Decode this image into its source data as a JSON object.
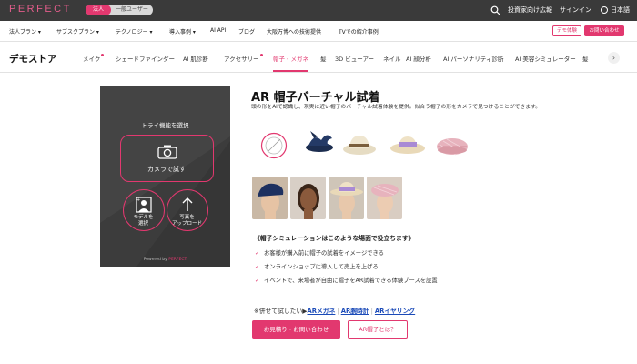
{
  "topbar": {
    "logo": "PERFECT",
    "segment_corporate": "法人",
    "segment_general": "一般ユーザー",
    "investor_label": "投資家向け広報",
    "signin_label": "サインイン",
    "language_label": "日本語"
  },
  "nav": {
    "items": [
      "法人プラン ▾",
      "サブスクプラン ▾",
      "テクノロジー ▾",
      "導入事例 ▾",
      "AI API",
      "ブログ",
      "大阪万博への技術提供",
      "TVでの紹介事例"
    ],
    "demo_label": "デモ体験",
    "contact_label": "お問い合わせ"
  },
  "store": {
    "title": "デモストア",
    "items": [
      "メイク",
      "シェードファインダー",
      "AI 肌診断",
      "アクセサリー",
      "帽子・メガネ",
      "髪",
      "3D ビューアー",
      "ネイル",
      "AI 顔分析",
      "AI パーソナリティ診断",
      "AI 美容シミュレーター",
      "髪"
    ],
    "active_item": "帽子・メガネ",
    "more_label": "›"
  },
  "panel": {
    "title": "トライ機能を選択",
    "camera_label": "カメラで試す",
    "model_label_1": "モデルを",
    "model_label_2": "選択",
    "upload_label_1": "写真を",
    "upload_label_2": "アップロード",
    "powered_prefix": "Powered by ",
    "powered_brand": "PERFECT"
  },
  "main": {
    "title": "AR 帽子バーチャル試着",
    "description": "頭の形をAIで認識し、現実に近い帽子のバーチャル試着体験を提供。似合う帽子の形をカメラで見つけることができます。",
    "hats": [
      "none",
      "navy-fascinator",
      "straw-fedora",
      "lavender-sunhat",
      "pink-beret"
    ],
    "models": [
      "model-navy-hat",
      "model-plain",
      "model-lavender-hat",
      "model-pink-beret"
    ],
    "usage_heading": "《帽子シミュレーションはこのような場面で役立ちます》",
    "bullets": [
      "お客様が購入前に帽子の試着をイメージできる",
      "オンラインショップに導入して売上を上げる",
      "イベントで、来場者が自由に帽子をAR試着できる体験ブースを設置"
    ],
    "also_prefix": "※併せて試したい▶",
    "also_links": [
      "ARメガネ",
      "AR腕時計",
      "ARイヤリング"
    ],
    "primary_button": "お見積り・お問い合わせ",
    "secondary_button": "AR帽子とは？"
  },
  "colors": {
    "accent": "#e2386f",
    "topbar": "#3a3a3a",
    "panel": "#3c3c3c",
    "link": "#1a4ab8"
  }
}
